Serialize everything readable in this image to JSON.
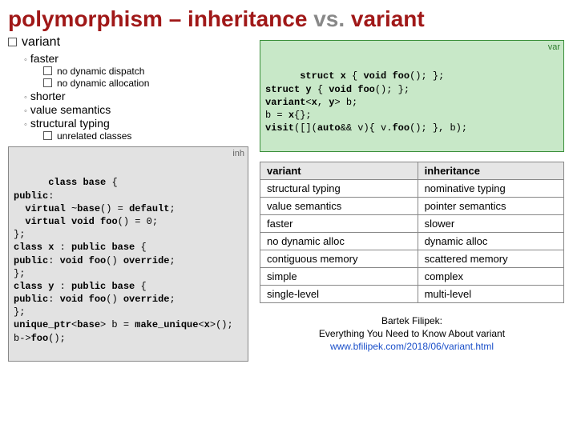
{
  "title": {
    "part1": "polymorphism – inheritance",
    "vs": " vs. ",
    "part2": "variant"
  },
  "bullets": {
    "main": "variant",
    "items": [
      {
        "label": "faster",
        "sub": [
          "no dynamic dispatch",
          "no dynamic allocation"
        ]
      },
      {
        "label": "shorter"
      },
      {
        "label": "value semantics"
      },
      {
        "label": "structural typing",
        "sub": [
          "unrelated classes"
        ]
      }
    ]
  },
  "code_inh": {
    "tag": "inh",
    "text": "class base {\npublic:\n  virtual ~base() = default;\n  virtual void foo() = 0;\n};\nclass x : public base {\npublic: void foo() override;\n};\nclass y : public base {\npublic: void foo() override;\n};\nunique_ptr<base> b = make_unique<x>();\nb->foo();"
  },
  "code_var": {
    "tag": "var",
    "text": "struct x { void foo(); };\nstruct y { void foo(); };\nvariant<x, y> b;\nb = x{};\nvisit([](auto&& v){ v.foo(); }, b);"
  },
  "table": {
    "headers": [
      "variant",
      "inheritance"
    ],
    "rows": [
      [
        "structural typing",
        "nominative typing"
      ],
      [
        "value semantics",
        "pointer semantics"
      ],
      [
        "faster",
        "slower"
      ],
      [
        "no dynamic alloc",
        "dynamic alloc"
      ],
      [
        "contiguous memory",
        "scattered memory"
      ],
      [
        "simple",
        "complex"
      ],
      [
        "single-level",
        "multi-level"
      ]
    ]
  },
  "citation": {
    "author": "Bartek Filipek:",
    "title": "Everything You Need to Know About variant",
    "url": "www.bfilipek.com/2018/06/variant.html"
  }
}
